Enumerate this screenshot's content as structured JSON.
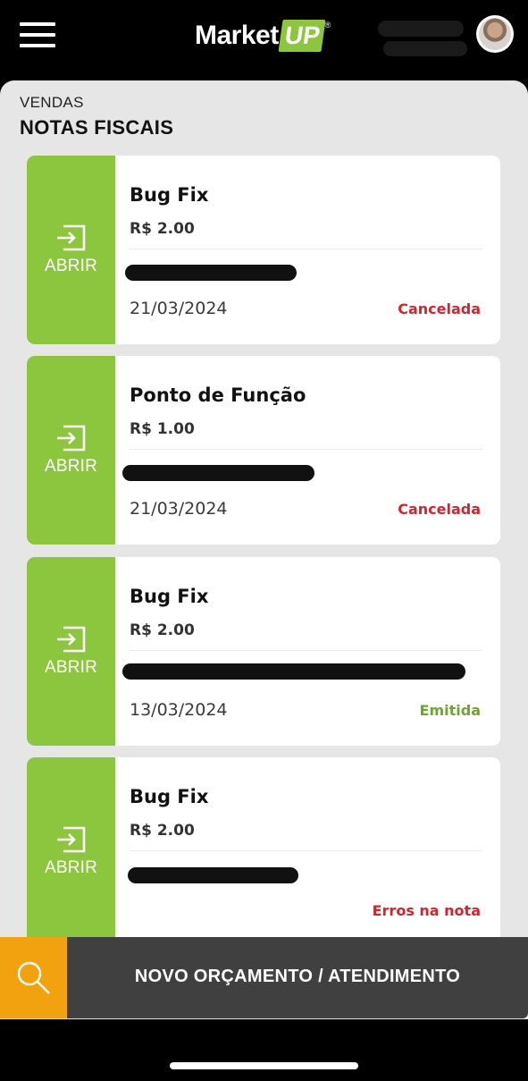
{
  "header": {
    "menu_icon": "hamburger-menu-icon",
    "logo": {
      "text": "Market",
      "badge": "UP",
      "mark": "®"
    },
    "avatar_icon": "user-avatar"
  },
  "page": {
    "section": "VENDAS",
    "title": "NOTAS FISCAIS"
  },
  "colors": {
    "brand_green": "#8cc63f",
    "status_red": "#d0262c",
    "status_green": "#6ea52e",
    "search_orange": "#f2a20f",
    "bar_dark": "#404040"
  },
  "invoices": [
    {
      "open_label": "ABRIR",
      "open_icon": "open-enter-icon",
      "title": "Bug Fix",
      "price": "R$ 2.00",
      "date": "21/03/2024",
      "status": "Cancelada",
      "status_type": "cancelled"
    },
    {
      "open_label": "ABRIR",
      "open_icon": "open-enter-icon",
      "title": "Ponto de Função",
      "price": "R$ 1.00",
      "date": "21/03/2024",
      "status": "Cancelada",
      "status_type": "cancelled"
    },
    {
      "open_label": "ABRIR",
      "open_icon": "open-enter-icon",
      "title": "Bug Fix",
      "price": "R$ 2.00",
      "date": "13/03/2024",
      "status": "Emitida",
      "status_type": "issued"
    },
    {
      "open_label": "ABRIR",
      "open_icon": "open-enter-icon",
      "title": "Bug Fix",
      "price": "R$ 2.00",
      "date": "",
      "status": "Erros na nota",
      "status_type": "error"
    }
  ],
  "bottom_bar": {
    "search_icon": "search-icon",
    "new_button_label": "NOVO ORÇAMENTO / ATENDIMENTO"
  }
}
